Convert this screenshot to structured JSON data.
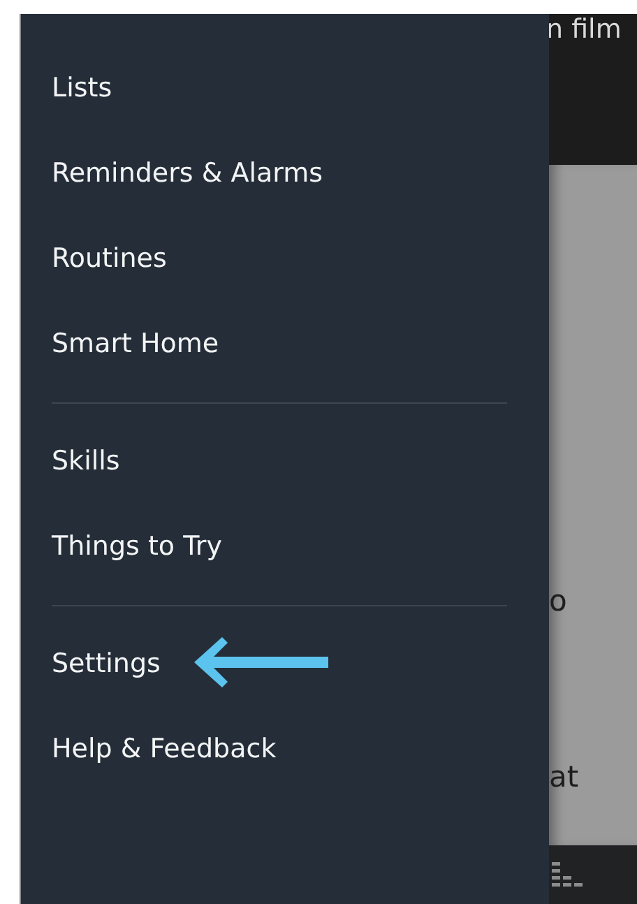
{
  "drawer": {
    "sections": [
      {
        "items": [
          {
            "label": "Lists",
            "pointed": false
          },
          {
            "label": "Reminders & Alarms",
            "pointed": false
          },
          {
            "label": "Routines",
            "pointed": false
          },
          {
            "label": "Smart Home",
            "pointed": false
          }
        ]
      },
      {
        "items": [
          {
            "label": "Skills",
            "pointed": false
          },
          {
            "label": "Things to Try",
            "pointed": false
          }
        ]
      },
      {
        "items": [
          {
            "label": "Settings",
            "pointed": true
          },
          {
            "label": "Help & Feedback",
            "pointed": false
          }
        ]
      }
    ]
  },
  "background": {
    "header_text": "n film",
    "card_texts": [
      "o",
      "at"
    ]
  }
}
